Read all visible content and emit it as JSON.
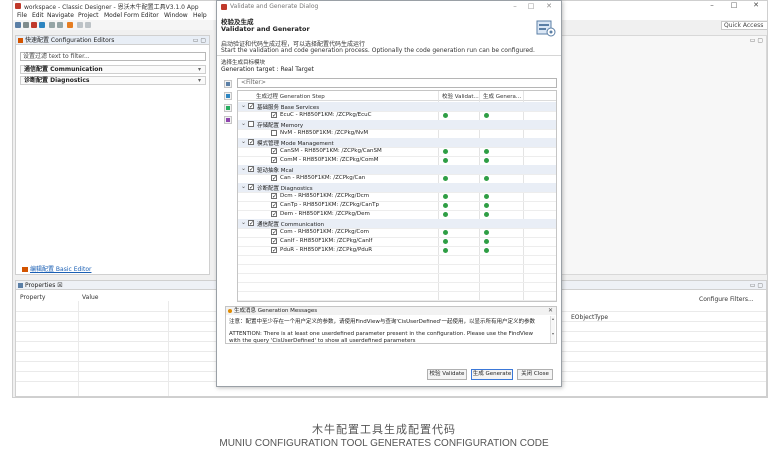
{
  "window": {
    "title": "workspace - Classic Designer - 恩沃木牛配置工具V3.1.0 App",
    "minimize": "–",
    "maximize": "□",
    "close": "✕",
    "quick_access": "Quick Access"
  },
  "menu": [
    "File",
    "Edit",
    "Navigate",
    "Project",
    "Model Form Editor",
    "Window",
    "Help"
  ],
  "editor": {
    "tab_label": "快速配置 Configuration Editors",
    "tab_controls": "▭ ▢",
    "filter_placeholder": "设置过滤 text to filter...",
    "items": [
      {
        "label": "通信配置 Communication",
        "arrow": "▾"
      },
      {
        "label": "诊断配置 Diagnostics",
        "arrow": "▾"
      }
    ],
    "basic_editor_link": "编辑配置 Basic Editor"
  },
  "right_panel": {
    "controls": "▭ ▢"
  },
  "properties": {
    "tab_label": "Properties ☒",
    "tab_controls": "▭ ▢",
    "col_property": "Property",
    "col_value": "Value",
    "configure_filters": "Configure Filters...",
    "eobject_type": "EObjectType"
  },
  "dialog": {
    "title": "Validate and Generate Dialog",
    "controls": [
      "–",
      "□",
      "✕"
    ],
    "header_zh": "校验及生成",
    "header_en": "Validator and Generator",
    "desc_zh": "启动验证和代码生成过程，可以选择配置代码生成运行",
    "desc_en": "Start the validation and code generation process. Optionally the code generation run can be configured.",
    "target_zh": "选择生成目标模块",
    "target_en": "Generation target : Real Target",
    "filter_placeholder": "<Filter>",
    "columns": {
      "step": "生成过程 Generation Step",
      "validate": "校验 Validat...",
      "generate": "生成 Genera..."
    },
    "tree": [
      {
        "kind": "group",
        "label": "基础服务 Base Services",
        "checked": "✓",
        "validate": false,
        "generate": false
      },
      {
        "kind": "item",
        "label": "EcuC - RH850F1KM: /ZCPkg/EcuC",
        "checked": "✓",
        "validate": true,
        "generate": true
      },
      {
        "kind": "group",
        "label": "存储配置 Memory",
        "checked": "",
        "validate": false,
        "generate": false
      },
      {
        "kind": "item",
        "label": "NvM - RH850F1KM: /ZCPkg/NvM",
        "checked": "",
        "validate": false,
        "generate": false
      },
      {
        "kind": "group",
        "label": "模式管理 Mode Management",
        "checked": "✓",
        "validate": false,
        "generate": false
      },
      {
        "kind": "item",
        "label": "CanSM - RH850F1KM: /ZCPkg/CanSM",
        "checked": "✓",
        "validate": true,
        "generate": true
      },
      {
        "kind": "item",
        "label": "ComM - RH850F1KM: /ZCPkg/ComM",
        "checked": "✓",
        "validate": true,
        "generate": true
      },
      {
        "kind": "group",
        "label": "驱动抽象 Mcal",
        "checked": "✓",
        "validate": false,
        "generate": false
      },
      {
        "kind": "item",
        "label": "Can - RH850F1KM: /ZCPkg/Can",
        "checked": "✓",
        "validate": true,
        "generate": true
      },
      {
        "kind": "group",
        "label": "诊断配置 Diagnostics",
        "checked": "✓",
        "validate": false,
        "generate": false
      },
      {
        "kind": "item",
        "label": "Dcm - RH850F1KM: /ZCPkg/Dcm",
        "checked": "✓",
        "validate": true,
        "generate": true
      },
      {
        "kind": "item",
        "label": "CanTp - RH850F1KM: /ZCPkg/CanTp",
        "checked": "✓",
        "validate": true,
        "generate": true
      },
      {
        "kind": "item",
        "label": "Dem - RH850F1KM: /ZCPkg/Dem",
        "checked": "✓",
        "validate": true,
        "generate": true
      },
      {
        "kind": "group",
        "label": "通信配置 Communication",
        "checked": "✓",
        "validate": false,
        "generate": false
      },
      {
        "kind": "item",
        "label": "Com - RH850F1KM: /ZCPkg/Com",
        "checked": "✓",
        "validate": true,
        "generate": true
      },
      {
        "kind": "item",
        "label": "CanIf - RH850F1KM: /ZCPkg/CanIf",
        "checked": "✓",
        "validate": true,
        "generate": true
      },
      {
        "kind": "item",
        "label": "PduR - RH850F1KM: /ZCPkg/PduR",
        "checked": "✓",
        "validate": true,
        "generate": true
      }
    ],
    "messages": {
      "header": "生成消息 Generation Messages",
      "close": "✕",
      "lines": [
        "注意：配置中至少存在一个用户定义的参数，请使用FindView与查询'CisUserDefined'一起使用，以显示所有用户定义的参数",
        "",
        "ATTENTION: There is at least one userdefined parameter present in the configuration. Please use the FindView",
        "with the query 'CisUserDefined' to show all userdefined parameters"
      ]
    },
    "buttons": {
      "validate": "校验 Validate",
      "generate": "生成 Generate",
      "close": "关闭 Close"
    }
  },
  "caption": {
    "zh": "木牛配置工具生成配置代码",
    "en": "MUNIU CONFIGURATION TOOL GENERATES CONFIGURATION CODE"
  }
}
